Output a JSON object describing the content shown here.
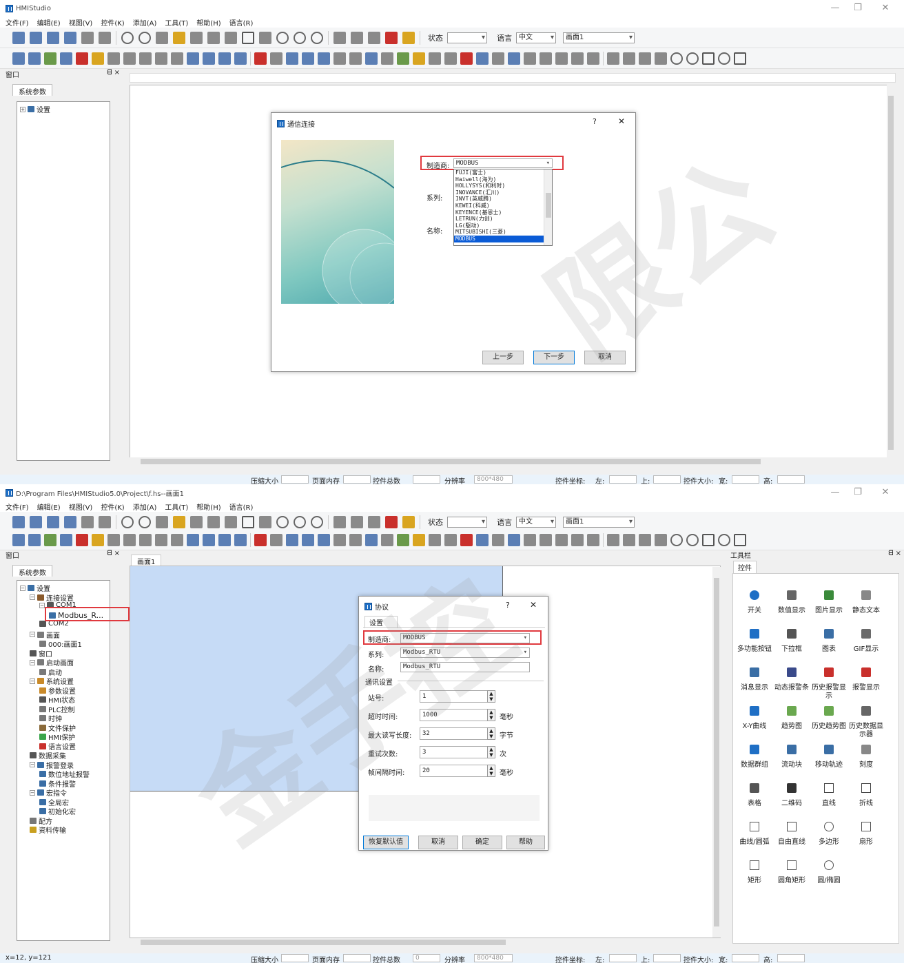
{
  "colors": {
    "accent": "#0078d7",
    "highlight": "#e0393e",
    "selected": "#0a5bd6",
    "canvas_blue": "#c6dbf6"
  },
  "menu": [
    "文件(F)",
    "编辑(E)",
    "视图(V)",
    "控件(K)",
    "添加(A)",
    "工具(T)",
    "帮助(H)",
    "语言(R)"
  ],
  "toolbar": {
    "state_label": "状态",
    "lang_label": "语言",
    "lang_value": "中文",
    "screen_value": "画面1"
  },
  "top": {
    "title": "HMIStudio",
    "panel_title": "窗口",
    "pin": "ᗺ ×",
    "tab": "系统参数",
    "tree_root": "设置",
    "dialog": {
      "title": "通信连接",
      "help": "?",
      "close": "✕",
      "maker_label": "制造商:",
      "maker_value": "MODBUS",
      "series_label": "系列:",
      "name_label": "名称:",
      "options": [
        "FUJI(富士)",
        "Haiwell(海为)",
        "HOLLYSYS(和利时)",
        "INOVANCE(汇川)",
        "INVT(英威腾)",
        "KEWEI(科威)",
        "KEYENCE(基恩士)",
        "LETRUN(力创)",
        "LG(駆动)",
        "MITSUBISHI(三菱)",
        "MODBUS"
      ],
      "prev": "上一步",
      "next": "下一步",
      "cancel": "取消"
    },
    "status": {
      "compress": "压缩大小",
      "page_mem": "页面内存",
      "ctrl_total": "控件总数",
      "ctrl_total_value": "",
      "resolution": "分辨率",
      "resolution_value": "800*480",
      "coord": "控件坐标:",
      "left": "左:",
      "up": "上:",
      "size": "控件大小:",
      "width": "宽:",
      "height": "高:"
    }
  },
  "bottom": {
    "title": "D:\\Program Files\\HMIStudio5.0\\Project\\f.hs--画面1",
    "panel_title": "窗口",
    "pin": "ᗺ ×",
    "tab": "系统参数",
    "screen_tab": "画面1",
    "tree": [
      {
        "label": "设置",
        "level": 0,
        "pm": "⊟"
      },
      {
        "label": "连接设置",
        "level": 1,
        "pm": "⊟"
      },
      {
        "label": "COM1",
        "level": 2,
        "pm": "⊟"
      },
      {
        "label": "Modbus_R...",
        "level": 3,
        "pm": ""
      },
      {
        "label": "COM2",
        "level": 2,
        "pm": ""
      },
      {
        "label": "画面",
        "level": 1,
        "pm": "⊟"
      },
      {
        "label": "000:画面1",
        "level": 2,
        "pm": ""
      },
      {
        "label": "窗口",
        "level": 1,
        "pm": ""
      },
      {
        "label": "启动画面",
        "level": 1,
        "pm": "⊟"
      },
      {
        "label": "启动",
        "level": 2,
        "pm": ""
      },
      {
        "label": "系统设置",
        "level": 1,
        "pm": "⊟"
      },
      {
        "label": "参数设置",
        "level": 2,
        "pm": ""
      },
      {
        "label": "HMI状态",
        "level": 2,
        "pm": ""
      },
      {
        "label": "PLC控制",
        "level": 2,
        "pm": ""
      },
      {
        "label": "时钟",
        "level": 2,
        "pm": ""
      },
      {
        "label": "文件保护",
        "level": 2,
        "pm": ""
      },
      {
        "label": "HMI保护",
        "level": 2,
        "pm": ""
      },
      {
        "label": "语言设置",
        "level": 2,
        "pm": ""
      },
      {
        "label": "数据采集",
        "level": 1,
        "pm": ""
      },
      {
        "label": "报警登录",
        "level": 1,
        "pm": "⊟"
      },
      {
        "label": "数位地址报警",
        "level": 2,
        "pm": ""
      },
      {
        "label": "条件报警",
        "level": 2,
        "pm": ""
      },
      {
        "label": "宏指令",
        "level": 1,
        "pm": "⊟"
      },
      {
        "label": "全局宏",
        "level": 2,
        "pm": ""
      },
      {
        "label": "初始化宏",
        "level": 2,
        "pm": ""
      },
      {
        "label": "配方",
        "level": 1,
        "pm": ""
      },
      {
        "label": "资料传输",
        "level": 1,
        "pm": ""
      }
    ],
    "dialog": {
      "title": "协议",
      "help": "?",
      "close": "✕",
      "tab": "设置",
      "maker_label": "制造商:",
      "maker_value": "MODBUS",
      "series_label": "系列:",
      "series_value": "Modbus_RTU",
      "name_label": "名称:",
      "name_value": "Modbus_RTU",
      "comm_label": "通讯设置",
      "station_label": "站号:",
      "station_value": "1",
      "timeout_label": "超时时间:",
      "timeout_value": "1000",
      "timeout_unit": "毫秒",
      "maxlen_label": "最大读写长度:",
      "maxlen_value": "32",
      "maxlen_unit": "字节",
      "retry_label": "重试次数:",
      "retry_value": "3",
      "retry_unit": "次",
      "frame_label": "帧间隔时间:",
      "frame_value": "20",
      "frame_unit": "毫秒",
      "restore": "恢复默认值",
      "cancel": "取消",
      "ok": "确定",
      "help_btn": "帮助"
    },
    "toolbox": {
      "title": "工具栏",
      "pin": "ᗺ ×",
      "tab": "控件",
      "items": [
        {
          "label": "开关",
          "icon": "switch-icon"
        },
        {
          "label": "数值显示",
          "icon": "numeric-icon"
        },
        {
          "label": "图片显示",
          "icon": "picture-icon"
        },
        {
          "label": "静态文本",
          "icon": "text-icon"
        },
        {
          "label": "多功能按钮",
          "icon": "multi-button-icon"
        },
        {
          "label": "下拉框",
          "icon": "dropdown-icon"
        },
        {
          "label": "图表",
          "icon": "chart-icon"
        },
        {
          "label": "GIF显示",
          "icon": "gif-icon"
        },
        {
          "label": "消息显示",
          "icon": "message-icon"
        },
        {
          "label": "动态报警条",
          "icon": "alarm-bar-icon"
        },
        {
          "label": "历史报警显示",
          "icon": "history-alarm-icon"
        },
        {
          "label": "报警显示",
          "icon": "alarm-icon"
        },
        {
          "label": "X-Y曲线",
          "icon": "xy-curve-icon"
        },
        {
          "label": "趋势图",
          "icon": "trend-icon"
        },
        {
          "label": "历史趋势图",
          "icon": "history-trend-icon"
        },
        {
          "label": "历史数据显示器",
          "icon": "history-data-icon"
        },
        {
          "label": "数据群组",
          "icon": "data-group-icon"
        },
        {
          "label": "流动块",
          "icon": "flow-block-icon"
        },
        {
          "label": "移动轨迹",
          "icon": "motion-path-icon"
        },
        {
          "label": "刻度",
          "icon": "scale-icon"
        },
        {
          "label": "表格",
          "icon": "table-icon"
        },
        {
          "label": "二维码",
          "icon": "qrcode-icon"
        },
        {
          "label": "直线",
          "icon": "line-icon"
        },
        {
          "label": "折线",
          "icon": "polyline-icon"
        },
        {
          "label": "曲线/圆弧",
          "icon": "curve-icon"
        },
        {
          "label": "自由直线",
          "icon": "freeline-icon"
        },
        {
          "label": "多边形",
          "icon": "polygon-icon"
        },
        {
          "label": "扇形",
          "icon": "sector-icon"
        },
        {
          "label": "矩形",
          "icon": "rect-icon"
        },
        {
          "label": "圆角矩形",
          "icon": "round-rect-icon"
        },
        {
          "label": "圆/椭圆",
          "icon": "ellipse-icon"
        }
      ]
    },
    "status": {
      "coord_readout": "x=12, y=121",
      "compress": "压缩大小",
      "page_mem": "页面内存",
      "ctrl_total": "控件总数",
      "ctrl_total_value": "0",
      "resolution": "分辨率",
      "resolution_value": "800*480",
      "coord": "控件坐标:",
      "left": "左:",
      "up": "上:",
      "size": "控件大小:",
      "width": "宽:",
      "height": "高:"
    }
  }
}
